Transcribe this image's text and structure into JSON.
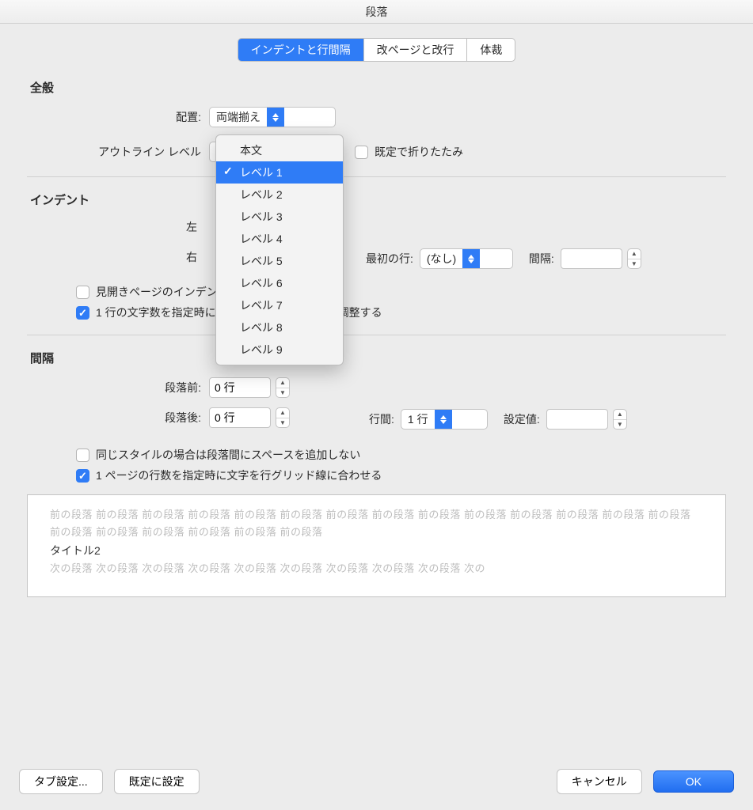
{
  "title": "段落",
  "tabs": {
    "t1": "インデントと行間隔",
    "t2": "改ページと改行",
    "t3": "体裁"
  },
  "general": {
    "heading": "全般",
    "align_label": "配置:",
    "align_value": "両端揃え",
    "outline_label": "アウトライン レベル",
    "collapse_label": "既定で折りたたみ"
  },
  "dropdown": {
    "items": [
      "本文",
      "レベル 1",
      "レベル 2",
      "レベル 3",
      "レベル 4",
      "レベル 5",
      "レベル 6",
      "レベル 7",
      "レベル 8",
      "レベル 9"
    ]
  },
  "indent": {
    "heading": "インデント",
    "left_label": "左",
    "right_label": "右",
    "firstline_label": "最初の行:",
    "firstline_value": "(なし)",
    "spacing_label": "間隔:",
    "mirror_label": "見開きページのインデント幅を設定する",
    "auto_label": "1 行の文字数を指定時に右のインデント幅を自動調整する"
  },
  "spacing": {
    "heading": "間隔",
    "before_label": "段落前:",
    "before_value": "0 行",
    "after_label": "段落後:",
    "after_value": "0 行",
    "line_label": "行間:",
    "line_value": "1 行",
    "setvalue_label": "設定値:",
    "nosame_label": "同じスタイルの場合は段落間にスペースを追加しない",
    "grid_label": "1 ページの行数を指定時に文字を行グリッド線に合わせる"
  },
  "preview": {
    "prev": "前の段落 前の段落 前の段落 前の段落 前の段落 前の段落 前の段落 前の段落 前の段落 前の段落 前の段落 前の段落 前の段落 前の段落 前の段落 前の段落 前の段落 前の段落 前の段落 前の段落",
    "sample": "タイトル2",
    "next": "次の段落 次の段落 次の段落 次の段落 次の段落 次の段落 次の段落 次の段落 次の段落 次の"
  },
  "buttons": {
    "tabs": "タブ設定...",
    "default": "既定に設定",
    "cancel": "キャンセル",
    "ok": "OK"
  }
}
